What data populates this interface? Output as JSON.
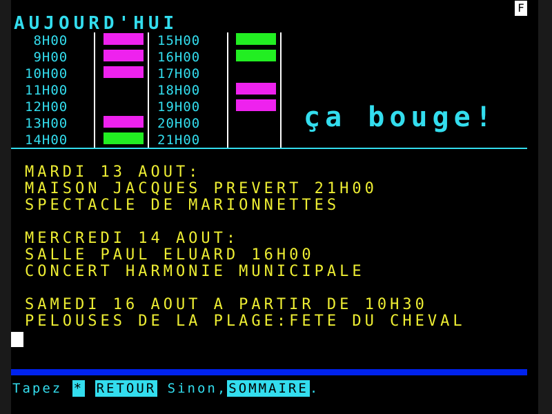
{
  "header": {
    "title": "AUJOURD'HUI",
    "indicator": "F",
    "tagline": "ça bouge!"
  },
  "schedule": {
    "left": [
      {
        "time": " 8H00",
        "status": "magenta"
      },
      {
        "time": " 9H00",
        "status": "magenta"
      },
      {
        "time": "10H00",
        "status": "magenta"
      },
      {
        "time": "11H00",
        "status": "none"
      },
      {
        "time": "12H00",
        "status": "none"
      },
      {
        "time": "13H00",
        "status": "magenta"
      },
      {
        "time": "14H00",
        "status": "green"
      }
    ],
    "right": [
      {
        "time": "15H00",
        "status": "green"
      },
      {
        "time": "16H00",
        "status": "green"
      },
      {
        "time": "17H00",
        "status": "none"
      },
      {
        "time": "18H00",
        "status": "magenta"
      },
      {
        "time": "19H00",
        "status": "magenta"
      },
      {
        "time": "20H00",
        "status": "none"
      },
      {
        "time": "21H00",
        "status": "none"
      }
    ],
    "colors": {
      "magenta": "#ee22ee",
      "green": "#22ee22"
    }
  },
  "events": [
    "MARDI 13 AOUT:",
    "MAISON JACQUES PREVERT 21H00",
    "SPECTACLE DE MARIONNETTES",
    "",
    "MERCREDI 14 AOUT:",
    "SALLE PAUL ELUARD 16H00",
    "CONCERT HARMONIE MUNICIPALE",
    "",
    "SAMEDI 16 AOUT A PARTIR DE 10H30",
    "PELOUSES DE LA PLAGE:FETE DU CHEVAL"
  ],
  "footer": {
    "tapez": "Tapez",
    "star_key": "*",
    "retour": "RETOUR",
    "sinon": "Sinon,",
    "sommaire": "SOMMAIRE",
    "period": "."
  },
  "palette": {
    "cyan": "#33ddee",
    "yellow": "#eeee33",
    "blue": "#0022ee",
    "white": "#ffffff",
    "background": "#000000"
  }
}
